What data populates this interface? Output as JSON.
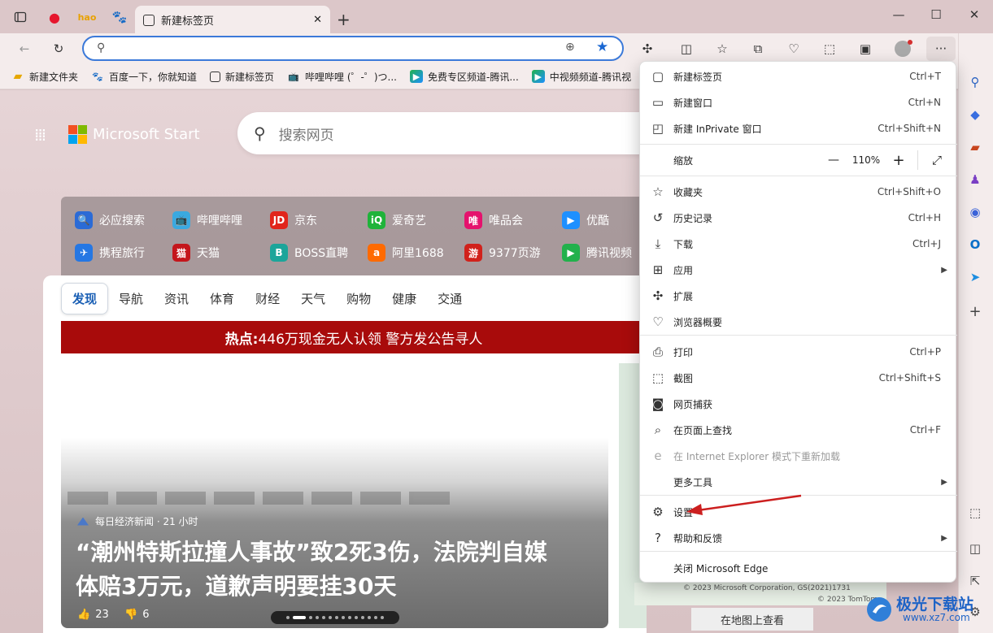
{
  "tabs": {
    "active_title": "新建标签页",
    "new_tab_symbol": "+"
  },
  "window_controls": {
    "minimize": "—",
    "maximize": "☐",
    "close": "✕"
  },
  "favorites": [
    {
      "label": "新建文件夹",
      "icon": "folder-icon"
    },
    {
      "label": "百度一下，你就知道",
      "icon": "baidu-icon"
    },
    {
      "label": "新建标签页",
      "icon": "newtab-icon"
    },
    {
      "label": "哔哩哔哩 (゜-゜)つ...",
      "icon": "bilibili-icon"
    },
    {
      "label": "免费专区频道-腾讯...",
      "icon": "tencent-video-icon"
    },
    {
      "label": "中视频频道-腾讯视",
      "icon": "tencent-video-icon"
    }
  ],
  "page": {
    "brand": "Microsoft Start",
    "search_placeholder": "搜索网页",
    "quicklinks": [
      {
        "label": "必应搜索",
        "glyph": "🔍",
        "color": "#2b6bd6"
      },
      {
        "label": "哔哩哔哩",
        "glyph": "📺",
        "color": "#3aa9e0"
      },
      {
        "label": "京东",
        "glyph": "JD",
        "color": "#e1251b"
      },
      {
        "label": "爱奇艺",
        "glyph": "iQ",
        "color": "#1fb33a"
      },
      {
        "label": "唯品会",
        "glyph": "唯",
        "color": "#e5126d"
      },
      {
        "label": "优酷",
        "glyph": "▶",
        "color": "#1e90ff"
      },
      {
        "label": "携程旅行",
        "glyph": "✈",
        "color": "#2577e3"
      },
      {
        "label": "天猫",
        "glyph": "猫",
        "color": "#c4161c"
      },
      {
        "label": "BOSS直聘",
        "glyph": "B",
        "color": "#1ca59a"
      },
      {
        "label": "阿里1688",
        "glyph": "a",
        "color": "#ff6a00"
      },
      {
        "label": "9377页游",
        "glyph": "游",
        "color": "#d1211b"
      },
      {
        "label": "腾讯视频",
        "glyph": "▶",
        "color": "#22b14c"
      }
    ],
    "feed_tabs": [
      "发现",
      "导航",
      "资讯",
      "体育",
      "财经",
      "天气",
      "购物",
      "健康",
      "交通"
    ],
    "hot_prefix": "热点:",
    "hot_text": " 446万现金无人认领 警方发公告寻人",
    "news": {
      "source": "每日经济新闻 · 21 小时",
      "headline_line1": "“潮州特斯拉撞人事故”致2死3伤，法院判自媒",
      "headline_line2": "体赔3万元，道歉声明要挂30天",
      "likes": "23",
      "dislikes": "6"
    },
    "map_footer": "在地图上查看",
    "map_copyright": "© 2023 Microsoft Corporation, GS(2021)1731",
    "map_copyright2": "© 2023 TomTom"
  },
  "menu": {
    "items": [
      {
        "label": "新建标签页",
        "shortcut": "Ctrl+T",
        "icon": "new-tab-icon"
      },
      {
        "label": "新建窗口",
        "shortcut": "Ctrl+N",
        "icon": "new-window-icon"
      },
      {
        "label": "新建 InPrivate 窗口",
        "shortcut": "Ctrl+Shift+N",
        "icon": "inprivate-icon"
      },
      {
        "label": "缩放",
        "zoom": "110%"
      },
      {
        "label": "收藏夹",
        "shortcut": "Ctrl+Shift+O",
        "icon": "favorites-icon"
      },
      {
        "label": "历史记录",
        "shortcut": "Ctrl+H",
        "icon": "history-icon"
      },
      {
        "label": "下载",
        "shortcut": "Ctrl+J",
        "icon": "download-icon"
      },
      {
        "label": "应用",
        "icon": "apps-icon",
        "submenu": true
      },
      {
        "label": "扩展",
        "icon": "extensions-icon"
      },
      {
        "label": "浏览器概要",
        "icon": "browser-essentials-icon"
      },
      {
        "label": "打印",
        "shortcut": "Ctrl+P",
        "icon": "print-icon"
      },
      {
        "label": "截图",
        "shortcut": "Ctrl+Shift+S",
        "icon": "screenshot-icon"
      },
      {
        "label": "网页捕获",
        "icon": "web-capture-icon"
      },
      {
        "label": "在页面上查找",
        "shortcut": "Ctrl+F",
        "icon": "find-icon"
      },
      {
        "label": "在 Internet Explorer 模式下重新加载",
        "icon": "ie-icon",
        "disabled": true
      },
      {
        "label": "更多工具",
        "submenu": true
      },
      {
        "label": "设置",
        "icon": "settings-icon"
      },
      {
        "label": "帮助和反馈",
        "icon": "help-icon",
        "submenu": true
      },
      {
        "label": "关闭 Microsoft Edge"
      }
    ],
    "zoom_minus": "—",
    "zoom_plus": "+"
  },
  "watermark": "极光下载站",
  "watermark_url": "www.xz7.com",
  "colors": {
    "accent": "#3b79d9",
    "hot_bar": "#a80b0b",
    "arrow": "#cc1f1f"
  }
}
